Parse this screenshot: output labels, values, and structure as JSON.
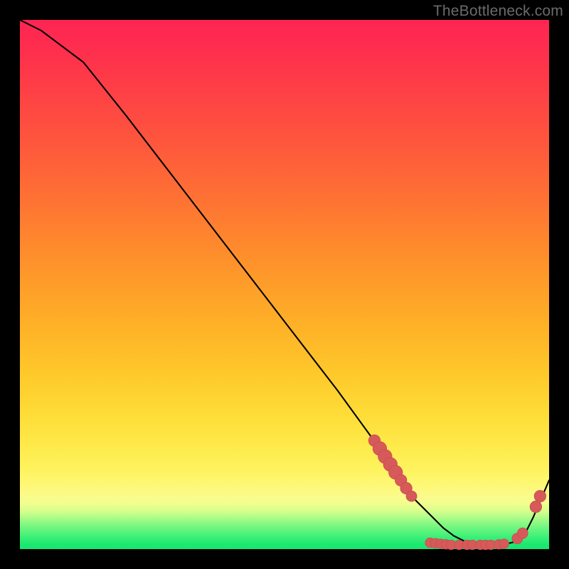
{
  "watermark": "TheBottleneck.com",
  "colors": {
    "markerFill": "#d75a5a",
    "markerStroke": "#c94f4f",
    "lineStroke": "#000000"
  },
  "chart_data": {
    "type": "line",
    "title": "",
    "xlabel": "",
    "ylabel": "",
    "xlim": [
      0,
      100
    ],
    "ylim": [
      0,
      100
    ],
    "grid": false,
    "legend": false,
    "series": [
      {
        "name": "bottleneck-curve",
        "x": [
          0,
          4,
          8,
          12,
          20,
          30,
          40,
          50,
          60,
          68,
          72,
          74,
          76,
          78,
          80,
          82,
          84,
          86,
          88,
          90,
          92,
          94,
          95.5,
          97,
          100
        ],
        "values": [
          100,
          98,
          95,
          92,
          82,
          69,
          56,
          43,
          30,
          19,
          13,
          10,
          8,
          6,
          4,
          2.5,
          1.5,
          1,
          0.8,
          0.8,
          1,
          1.5,
          3,
          6,
          13
        ]
      }
    ],
    "markers": [
      {
        "name": "cluster-descent",
        "points": [
          {
            "x": 67,
            "y": 20.5,
            "r": 1.1
          },
          {
            "x": 68,
            "y": 19.0,
            "r": 1.3
          },
          {
            "x": 69,
            "y": 17.5,
            "r": 1.3
          },
          {
            "x": 70,
            "y": 16.0,
            "r": 1.3
          },
          {
            "x": 71,
            "y": 14.5,
            "r": 1.3
          },
          {
            "x": 72,
            "y": 13.0,
            "r": 1.1
          },
          {
            "x": 73,
            "y": 11.5,
            "r": 1.1
          },
          {
            "x": 74,
            "y": 10.0,
            "r": 1.0
          }
        ]
      },
      {
        "name": "valley-dots",
        "points": [
          {
            "x": 77.5,
            "y": 1.2,
            "r": 0.9
          },
          {
            "x": 78.5,
            "y": 1.1,
            "r": 0.9
          },
          {
            "x": 79.5,
            "y": 1.0,
            "r": 0.9
          },
          {
            "x": 80.5,
            "y": 0.9,
            "r": 0.9
          },
          {
            "x": 81.5,
            "y": 0.8,
            "r": 0.9
          },
          {
            "x": 83.0,
            "y": 0.8,
            "r": 0.9
          },
          {
            "x": 84.5,
            "y": 0.8,
            "r": 0.9
          },
          {
            "x": 85.5,
            "y": 0.8,
            "r": 0.9
          },
          {
            "x": 87.0,
            "y": 0.8,
            "r": 0.9
          },
          {
            "x": 88.0,
            "y": 0.8,
            "r": 0.9
          },
          {
            "x": 89.0,
            "y": 0.8,
            "r": 0.9
          },
          {
            "x": 90.5,
            "y": 0.9,
            "r": 0.9
          },
          {
            "x": 91.5,
            "y": 1.0,
            "r": 0.9
          }
        ]
      },
      {
        "name": "ascent-dots",
        "points": [
          {
            "x": 94.0,
            "y": 2.0,
            "r": 1.0
          },
          {
            "x": 95.0,
            "y": 3.0,
            "r": 1.0
          },
          {
            "x": 97.5,
            "y": 8.0,
            "r": 1.1
          },
          {
            "x": 98.3,
            "y": 10.0,
            "r": 1.1
          }
        ]
      }
    ]
  }
}
